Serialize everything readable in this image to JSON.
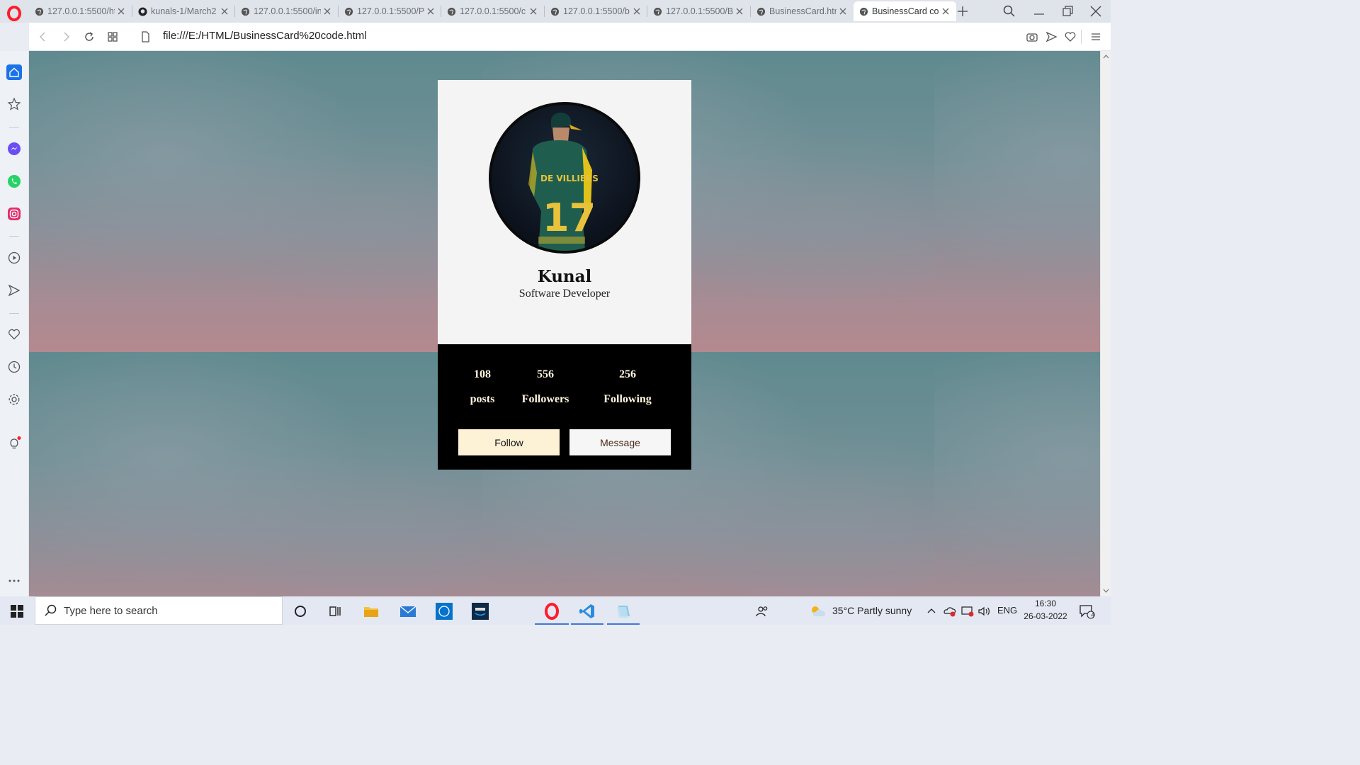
{
  "browser": {
    "tabs": [
      {
        "label": "127.0.0.1:5500/ht",
        "favicon": "globe-icon",
        "active": false
      },
      {
        "label": "kunals-1/March2",
        "favicon": "github-icon",
        "active": false
      },
      {
        "label": "127.0.0.1:5500/in",
        "favicon": "globe-icon",
        "active": false
      },
      {
        "label": "127.0.0.1:5500/P",
        "favicon": "globe-icon",
        "active": false
      },
      {
        "label": "127.0.0.1:5500/c",
        "favicon": "globe-icon",
        "active": false
      },
      {
        "label": "127.0.0.1:5500/b",
        "favicon": "globe-icon",
        "active": false
      },
      {
        "label": "127.0.0.1:5500/B",
        "favicon": "globe-icon",
        "active": false
      },
      {
        "label": "BusinessCard.htm",
        "favicon": "globe-icon",
        "active": false
      },
      {
        "label": "BusinessCard co",
        "favicon": "globe-icon",
        "active": true
      }
    ],
    "url": "file:///E:/HTML/BusinessCard%20code.html",
    "colors": {
      "accent": "#1a73e8",
      "opera_red": "#ff1b2d"
    }
  },
  "card": {
    "name": "Kunal",
    "role": "Software Developer",
    "photo_text": {
      "jersey_name": "DE VILLIERS",
      "jersey_number": "17"
    },
    "stats": [
      {
        "value": "108",
        "label": "posts"
      },
      {
        "value": "556",
        "label": "Followers"
      },
      {
        "value": "256",
        "label": "Following"
      }
    ],
    "buttons": {
      "follow": "Follow",
      "message": "Message"
    },
    "colors": {
      "top_bg": "#f4f4f4",
      "bottom_bg": "#000000",
      "stat_text": "#fff6e0",
      "follow_bg": "#fdf2d6"
    }
  },
  "taskbar": {
    "search_placeholder": "Type here to search",
    "weather": "35°C  Partly sunny",
    "language": "ENG",
    "time": "16:30",
    "date": "26-03-2022",
    "notification_count": "4"
  }
}
